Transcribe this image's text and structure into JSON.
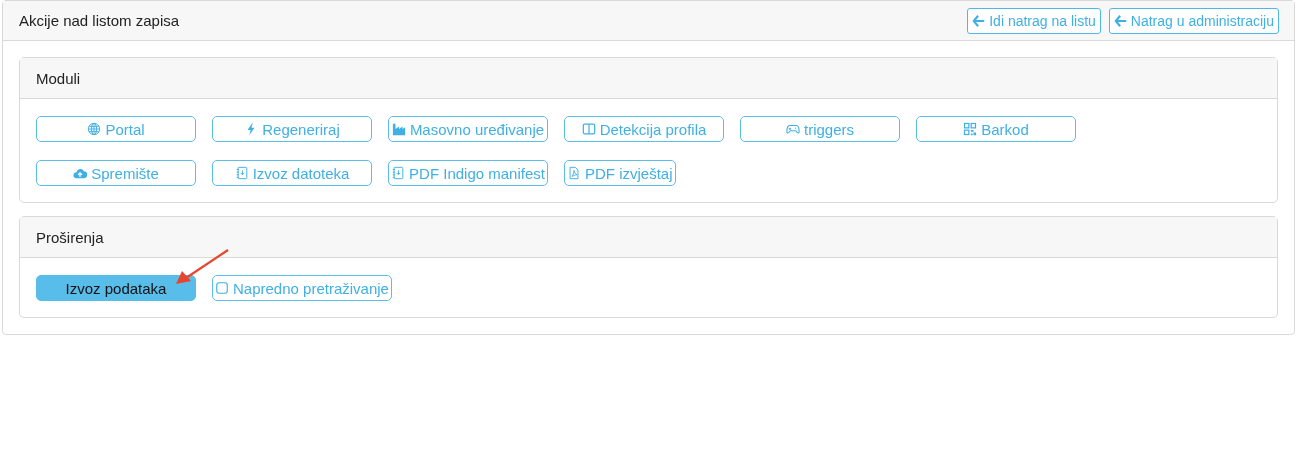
{
  "panel": {
    "title": "Akcije nad listom zapisa",
    "nav_buttons": [
      {
        "label": "Idi natrag na listu",
        "kind": "back"
      },
      {
        "label": "Natrag u administraciju",
        "kind": "back"
      }
    ]
  },
  "sections": [
    {
      "title": "Moduli",
      "buttons": [
        {
          "label": "Portal",
          "kind": "globe",
          "active": false
        },
        {
          "label": "Regeneriraj",
          "kind": "bolt",
          "active": false
        },
        {
          "label": "Masovno uređivanje",
          "kind": "factory",
          "active": false
        },
        {
          "label": "Detekcija profila",
          "kind": "columns",
          "active": false
        },
        {
          "label": "triggers",
          "kind": "gamepad",
          "active": false
        },
        {
          "label": "Barkod",
          "kind": "qr",
          "active": false
        },
        {
          "label": "Spremište",
          "kind": "cloud",
          "active": false
        },
        {
          "label": "Izvoz datoteka",
          "kind": "journal",
          "active": false
        },
        {
          "label": "PDF Indigo manifest",
          "kind": "journal",
          "active": false
        },
        {
          "label": "PDF izvještaj",
          "kind": "pdf",
          "active": false
        }
      ]
    },
    {
      "title": "Proširenja",
      "buttons": [
        {
          "label": "Izvoz podataka",
          "kind": "plain",
          "active": true
        },
        {
          "label": "Napredno pretraživanje",
          "kind": "square",
          "active": false
        }
      ]
    }
  ]
}
